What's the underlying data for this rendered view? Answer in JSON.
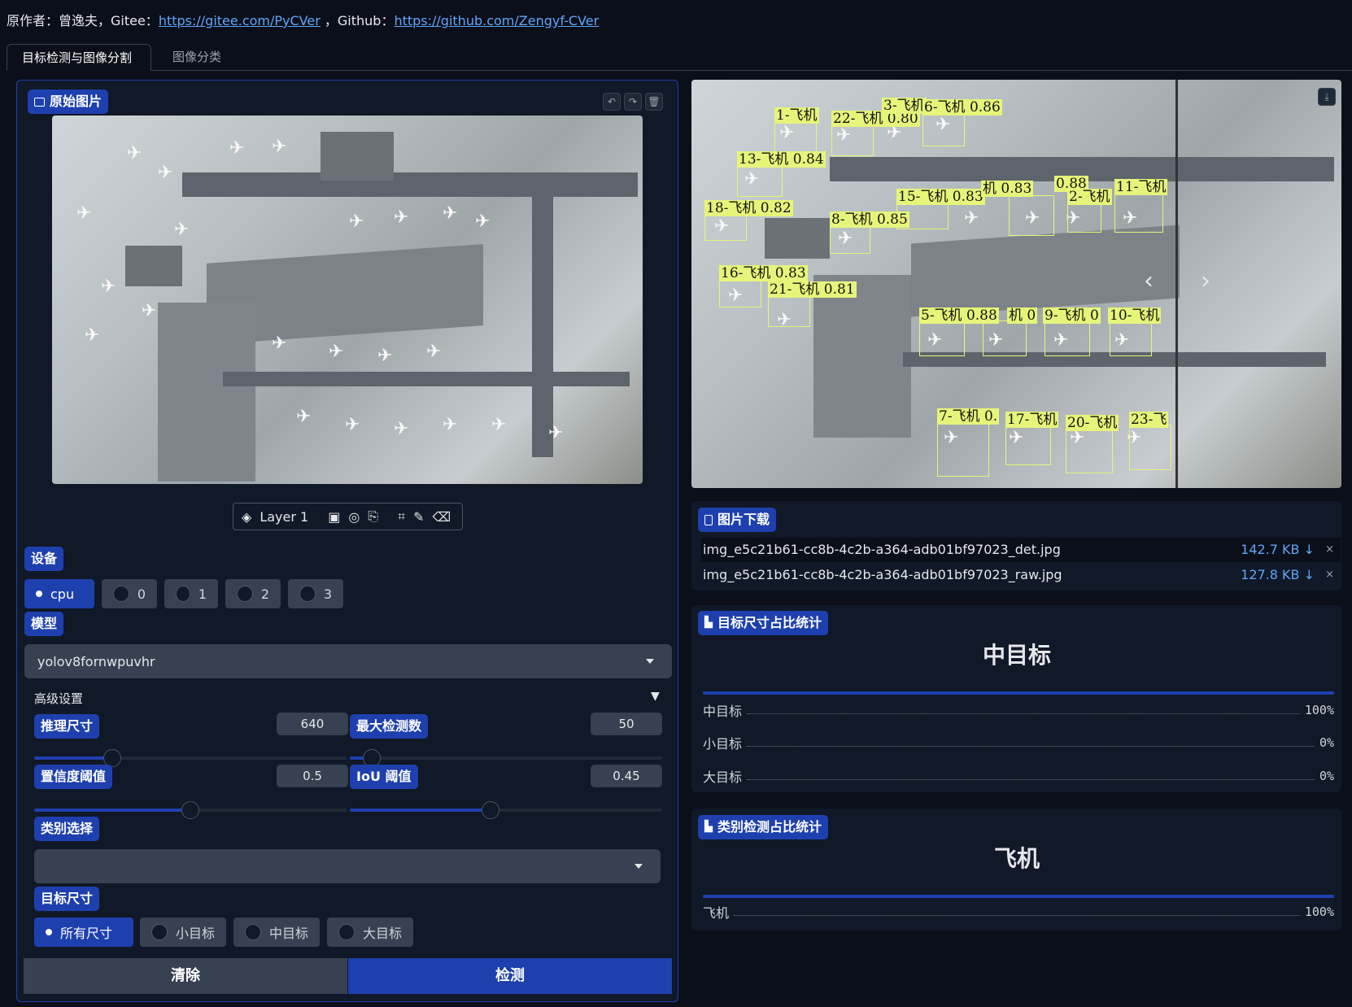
{
  "credit": {
    "prefix": "原作者：曾逸夫，Gitee：",
    "gitee_url": "https://gitee.com/PyCVer",
    "sep": "，Github：",
    "github_url": "https://github.com/Zengyf-CVer"
  },
  "tabs": [
    {
      "label": "目标检测与图像分割",
      "active": true
    },
    {
      "label": "图像分类",
      "active": false
    }
  ],
  "input_image": {
    "label": "原始图片"
  },
  "editor_toolbar": {
    "layer_label": "Layer 1"
  },
  "device": {
    "label": "设备",
    "options": [
      "cpu",
      "0",
      "1",
      "2",
      "3"
    ],
    "selected": "cpu"
  },
  "model": {
    "label": "模型",
    "value": "yolov8fornwpuvhr"
  },
  "advanced": {
    "label": "高级设置",
    "infer_size": {
      "label": "推理尺寸",
      "value": "640",
      "fraction": 0.25
    },
    "max_det": {
      "label": "最大检测数",
      "value": "50",
      "fraction": 0.07
    },
    "conf": {
      "label": "置信度阈值",
      "value": "0.5",
      "fraction": 0.5
    },
    "iou": {
      "label": "IoU 阈值",
      "value": "0.45",
      "fraction": 0.45
    }
  },
  "class_select": {
    "label": "类别选择",
    "value": ""
  },
  "target_size": {
    "label": "目标尺寸",
    "options": [
      "所有尺寸",
      "小目标",
      "中目标",
      "大目标"
    ],
    "selected": "所有尺寸"
  },
  "buttons": {
    "clear": "清除",
    "detect": "检测"
  },
  "detections": [
    {
      "text": "1-飞机"
    },
    {
      "text": "22-飞机 0.80"
    },
    {
      "text": "3-飞机"
    },
    {
      "text": "6-飞机 0.86"
    },
    {
      "text": "13-飞机 0.84"
    },
    {
      "text": "18-飞机 0.82"
    },
    {
      "text": "15-飞机 0.83"
    },
    {
      "text": "机 0.83"
    },
    {
      "text": "0.88"
    },
    {
      "text": "2-飞机"
    },
    {
      "text": "11-飞机"
    },
    {
      "text": "8-飞机 0.85"
    },
    {
      "text": "16-飞机 0.83"
    },
    {
      "text": "21-飞机 0.81"
    },
    {
      "text": "5-飞机 0.88"
    },
    {
      "text": "机 0"
    },
    {
      "text": "9-飞机 0"
    },
    {
      "text": "10-飞机"
    },
    {
      "text": "7-飞机 0."
    },
    {
      "text": "17-飞机"
    },
    {
      "text": "20-飞机"
    },
    {
      "text": "23-飞"
    }
  ],
  "download": {
    "label": "图片下载",
    "files": [
      {
        "name": "img_e5c21b61-cc8b-4c2b-a364-adb01bf97023_det.jpg",
        "size": "142.7 KB ↓",
        "remove": "×"
      },
      {
        "name": "img_e5c21b61-cc8b-4c2b-a364-adb01bf97023_raw.jpg",
        "size": "127.8 KB ↓",
        "remove": "×"
      }
    ]
  },
  "size_stats": {
    "label": "目标尺寸占比统计",
    "top": "中目标",
    "rows": [
      {
        "name": "中目标",
        "pct": "100%"
      },
      {
        "name": "小目标",
        "pct": "0%"
      },
      {
        "name": "大目标",
        "pct": "0%"
      }
    ]
  },
  "class_stats": {
    "label": "类别检测占比统计",
    "top": "飞机",
    "rows": [
      {
        "name": "飞机",
        "pct": "100%"
      }
    ]
  },
  "colors": {
    "accent": "#1e40af",
    "bbox": "#e6f57a",
    "background": "#0b0f19",
    "panel": "#111827"
  }
}
